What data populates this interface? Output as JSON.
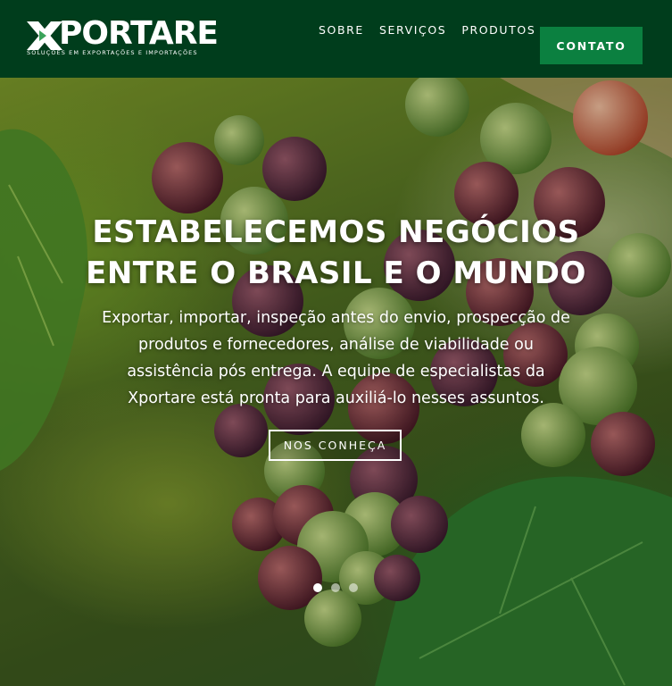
{
  "header": {
    "logo": {
      "wordmark": "PORTARE",
      "mark_letter": "X",
      "tagline": "SOLUÇÕES EM EXPORTAÇÕES E IMPORTAÇÕES"
    },
    "nav": [
      {
        "label": "SOBRE"
      },
      {
        "label": "SERVIÇOS"
      },
      {
        "label": "PRODUTOS"
      }
    ],
    "cta_label": "CONTATO"
  },
  "hero": {
    "title_line1": "ESTABELECEMOS NEGÓCIOS",
    "title_line2": "ENTRE O BRASIL E O MUNDO",
    "text": "Exportar, importar, inspeção antes do envio, prospecção de produtos e fornecedores, análise de viabilidade ou assistência pós entrega. A equipe de especialistas da Xportare está pronta para auxiliá-lo nesses assuntos.",
    "button_label": "NOS CONHEÇA",
    "slides": [
      {
        "active": true
      },
      {
        "active": false
      },
      {
        "active": false
      }
    ]
  },
  "colors": {
    "header_bg": "#003d1c",
    "cta_bg": "#0b8040",
    "text": "#ffffff"
  }
}
